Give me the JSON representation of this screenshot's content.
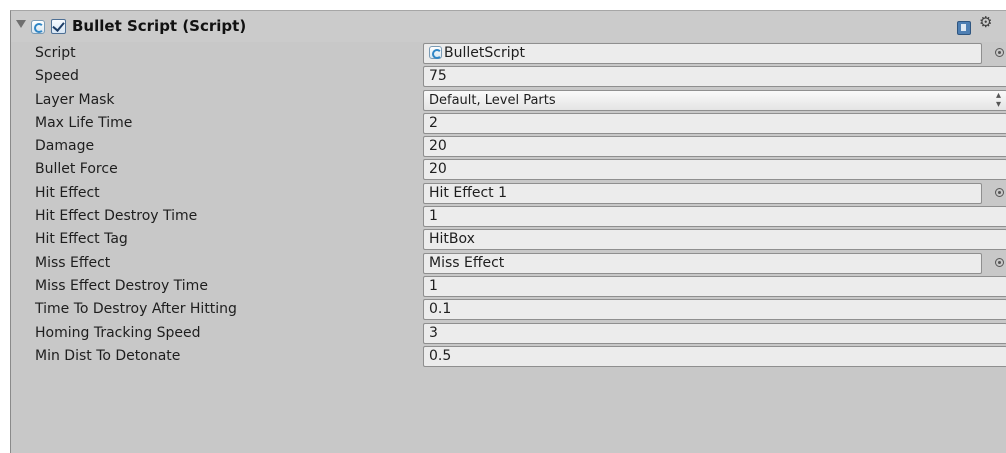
{
  "component": {
    "title": "Bullet Script (Script)",
    "enabled": true
  },
  "icons": {
    "fold": "triangle-down-icon",
    "script": "csharp-script-icon",
    "help": "help-book-icon",
    "settings": "gear-icon",
    "object_picker": "object-picker-icon"
  },
  "fields": {
    "script": {
      "label": "Script",
      "value": "BulletScript"
    },
    "speed": {
      "label": "Speed",
      "value": "75"
    },
    "layer_mask": {
      "label": "Layer Mask",
      "value": "Default, Level Parts"
    },
    "max_life_time": {
      "label": "Max Life Time",
      "value": "2"
    },
    "damage": {
      "label": "Damage",
      "value": "20"
    },
    "bullet_force": {
      "label": "Bullet Force",
      "value": "20"
    },
    "hit_effect": {
      "label": "Hit Effect",
      "value": "Hit Effect 1"
    },
    "hit_effect_destroy_time": {
      "label": "Hit Effect Destroy Time",
      "value": "1"
    },
    "hit_effect_tag": {
      "label": "Hit Effect Tag",
      "value": "HitBox"
    },
    "miss_effect": {
      "label": "Miss Effect",
      "value": "Miss Effect"
    },
    "miss_effect_destroy_time": {
      "label": "Miss Effect Destroy Time",
      "value": "1"
    },
    "time_to_destroy_after_hitting": {
      "label": "Time To Destroy After Hitting",
      "value": "0.1"
    },
    "homing_tracking_speed": {
      "label": "Homing Tracking Speed",
      "value": "3"
    },
    "min_dist_to_detonate": {
      "label": "Min Dist To Detonate",
      "value": "0.5"
    }
  },
  "colors": {
    "panel_background": "#c8c8c8",
    "field_background": "#ececec",
    "checkbox_accent": "#4d6f94"
  }
}
